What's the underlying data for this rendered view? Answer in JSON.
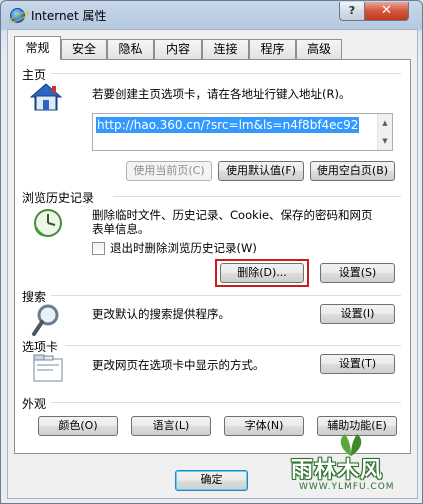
{
  "window": {
    "title": "Internet 属性",
    "help_label": "?",
    "close_label": "✕"
  },
  "tabs": [
    {
      "label": "常规"
    },
    {
      "label": "安全"
    },
    {
      "label": "隐私"
    },
    {
      "label": "内容"
    },
    {
      "label": "连接"
    },
    {
      "label": "程序"
    },
    {
      "label": "高级"
    }
  ],
  "home": {
    "label": "主页",
    "desc": "若要创建主页选项卡，请在各地址行键入地址(R)。",
    "url": "http://hao.360.cn/?src=lm&ls=n4f8bf4ec92",
    "use_current": "使用当前页(C)",
    "use_default": "使用默认值(F)",
    "use_blank": "使用空白页(B)"
  },
  "history": {
    "label": "浏览历史记录",
    "desc_line1": "删除临时文件、历史记录、Cookie、保存的密码和网页",
    "desc_line2": "表单信息。",
    "checkbox_label": "退出时删除浏览历史记录(W)",
    "checked": false,
    "delete_label": "删除(D)...",
    "settings_label": "设置(S)"
  },
  "search": {
    "label": "搜索",
    "desc": "更改默认的搜索提供程序。",
    "settings_label": "设置(I)"
  },
  "tabs_section": {
    "label": "选项卡",
    "desc": "更改网页在选项卡中显示的方式。",
    "settings_label": "设置(T)"
  },
  "appearance": {
    "label": "外观",
    "colors": "颜色(O)",
    "languages": "语言(L)",
    "fonts": "字体(N)",
    "accessibility": "辅助功能(E)"
  },
  "footer": {
    "ok_label": "确定"
  },
  "watermark": {
    "brand": "雨林木风",
    "url": "WWW.YLMFU.COM"
  },
  "colors": {
    "highlight_red": "#d01a1a",
    "selection_blue": "#3399ff"
  }
}
